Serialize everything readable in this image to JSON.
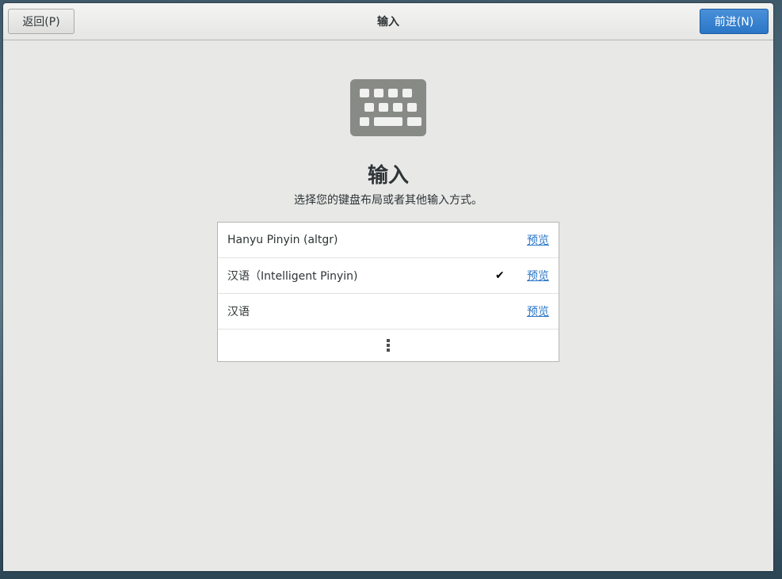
{
  "header": {
    "back_label": "返回(P)",
    "title": "输入",
    "next_label": "前进(N)"
  },
  "main": {
    "icon": "keyboard-icon",
    "heading": "输入",
    "subtitle": "选择您的键盘布局或者其他输入方式。"
  },
  "input_sources": [
    {
      "label": "Hanyu Pinyin (altgr)",
      "selected": false,
      "preview_label": "预览"
    },
    {
      "label": "汉语（Intelligent Pinyin)",
      "selected": true,
      "preview_label": "预览"
    },
    {
      "label": "汉语",
      "selected": false,
      "preview_label": "预览"
    }
  ],
  "more_icon": "more-vertical-icon",
  "colors": {
    "accent": "#2a76c6",
    "background": "#e8e8e7"
  }
}
